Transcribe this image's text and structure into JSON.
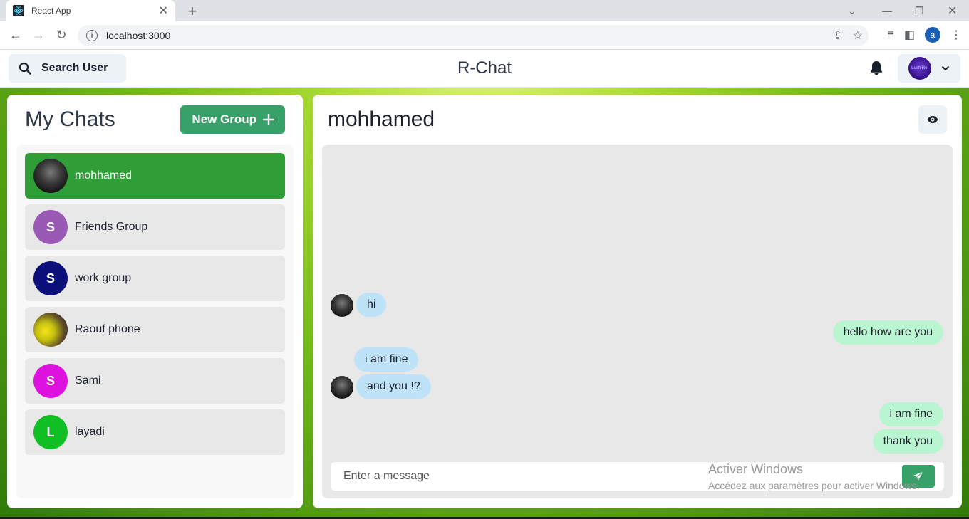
{
  "browser": {
    "tab_title": "React App",
    "url": "localhost:3000",
    "profile_initial": "a"
  },
  "header": {
    "search_label": "Search User",
    "app_title": "R-Chat",
    "user_avatar_text": "Lush Rel"
  },
  "sidebar": {
    "title": "My Chats",
    "new_group_label": "New Group",
    "chats": [
      {
        "name": "mohhamed",
        "initial": "",
        "avatar_color": "",
        "photo": "dark-portrait",
        "active": true
      },
      {
        "name": "Friends Group",
        "initial": "S",
        "avatar_color": "#9b59b6",
        "photo": "",
        "active": false
      },
      {
        "name": "work group",
        "initial": "S",
        "avatar_color": "#0b0f7a",
        "photo": "",
        "active": false
      },
      {
        "name": "Raouf phone",
        "initial": "",
        "avatar_color": "",
        "photo": "yellow-bird",
        "active": false
      },
      {
        "name": "Sami",
        "initial": "S",
        "avatar_color": "#de12de",
        "photo": "",
        "active": false
      },
      {
        "name": "layadi",
        "initial": "L",
        "avatar_color": "#0fbf24",
        "photo": "",
        "active": false
      }
    ]
  },
  "chat": {
    "title": "mohhamed",
    "messages": [
      {
        "text": "hi",
        "direction": "in"
      },
      {
        "text": "hello how are you",
        "direction": "out"
      },
      {
        "text": "i am fine",
        "direction": "in"
      },
      {
        "text": "and you !?",
        "direction": "in"
      },
      {
        "text": "i am fine",
        "direction": "out"
      },
      {
        "text": "thank you",
        "direction": "out"
      }
    ],
    "input_placeholder": "Enter a message"
  },
  "watermark": {
    "line1": "Activer Windows",
    "line2": "Accédez aux paramètres pour activer Windows."
  }
}
